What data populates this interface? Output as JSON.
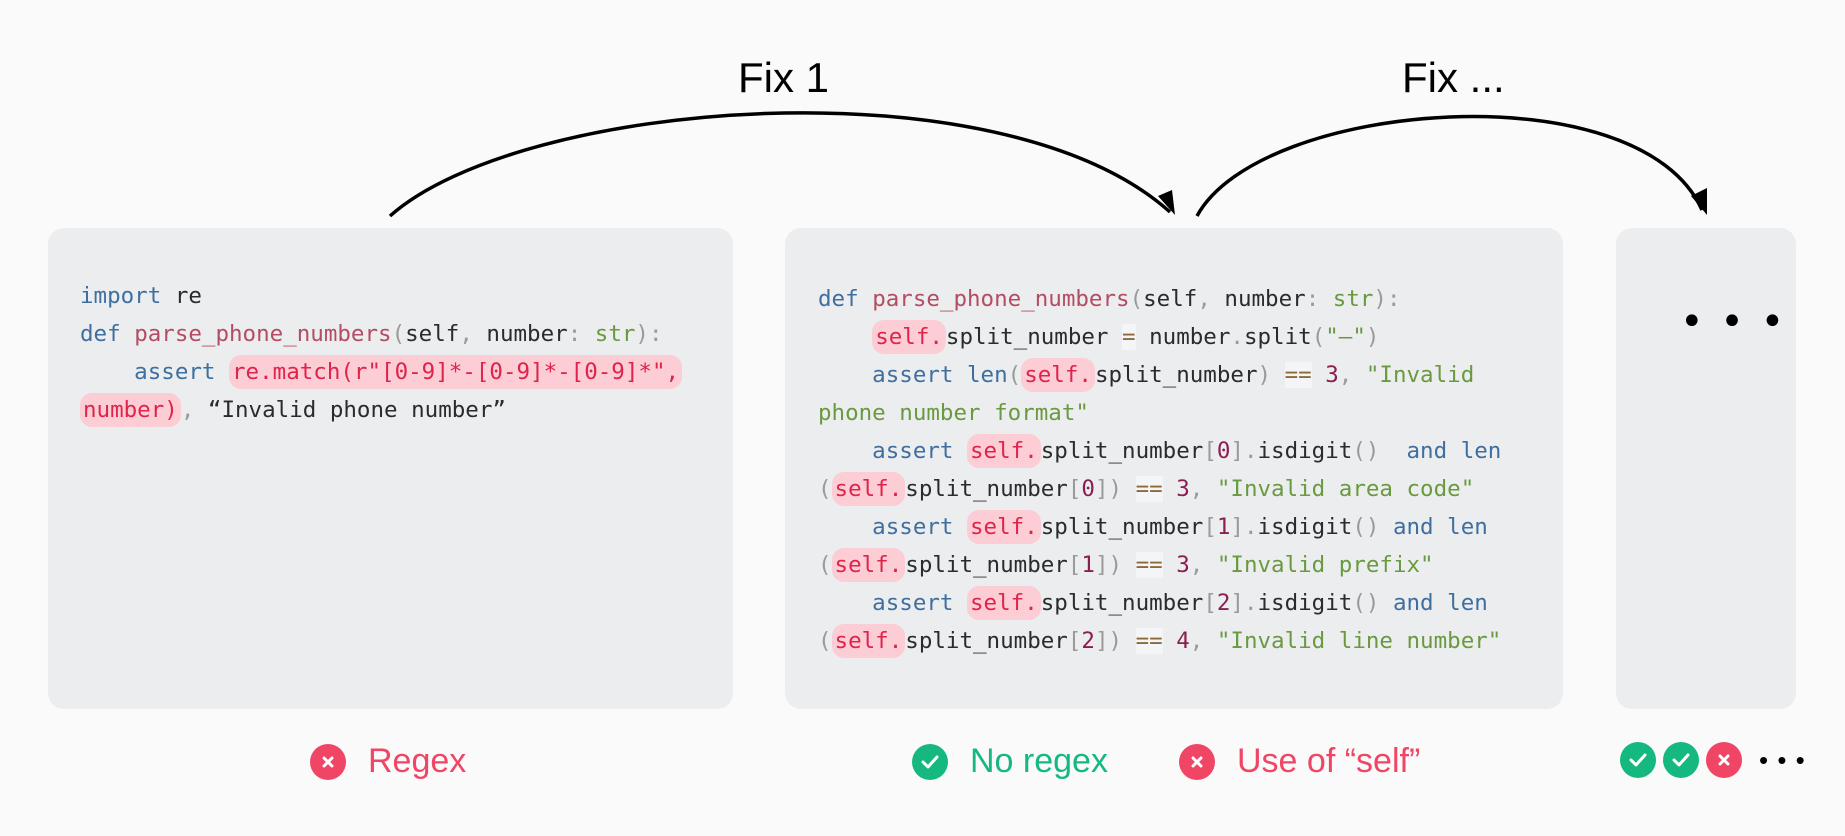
{
  "arrows": {
    "fix1_label": "Fix 1",
    "fix2_label": "Fix ..."
  },
  "box1": {
    "lines": [
      [
        {
          "t": "import",
          "c": "kw"
        },
        {
          "t": " re",
          "c": "plain"
        }
      ],
      [
        {
          "t": "def ",
          "c": "kw"
        },
        {
          "t": "parse_phone_numbers",
          "c": "fn"
        },
        {
          "t": "(",
          "c": "pu"
        },
        {
          "t": "self",
          "c": "plain"
        },
        {
          "t": ", ",
          "c": "pu"
        },
        {
          "t": "number",
          "c": "plain"
        },
        {
          "t": ": ",
          "c": "pu"
        },
        {
          "t": "str",
          "c": "ty"
        },
        {
          "t": "):",
          "c": "pu"
        }
      ],
      [
        {
          "t": "    assert ",
          "c": "kw"
        },
        {
          "t": "re.match(r\"[0-9]*-[0-9]*-[0-9]*\",",
          "c": "hl"
        }
      ],
      [
        {
          "t": "number)",
          "c": "hl"
        },
        {
          "t": ", ",
          "c": "pu"
        },
        {
          "t": "“Invalid phone number”",
          "c": "plain"
        }
      ]
    ]
  },
  "box2": {
    "lines": [
      [
        {
          "t": "def ",
          "c": "kw"
        },
        {
          "t": "parse_phone_numbers",
          "c": "fn"
        },
        {
          "t": "(",
          "c": "pu"
        },
        {
          "t": "self",
          "c": "plain"
        },
        {
          "t": ", ",
          "c": "pu"
        },
        {
          "t": "number",
          "c": "plain"
        },
        {
          "t": ": ",
          "c": "pu"
        },
        {
          "t": "str",
          "c": "ty"
        },
        {
          "t": "):",
          "c": "pu"
        }
      ],
      [
        {
          "t": "    ",
          "c": "plain"
        },
        {
          "t": "self.",
          "c": "hl"
        },
        {
          "t": "split_number ",
          "c": "plain"
        },
        {
          "t": "=",
          "c": "op"
        },
        {
          "t": " number",
          "c": "plain"
        },
        {
          "t": ".",
          "c": "pu"
        },
        {
          "t": "split",
          "c": "plain"
        },
        {
          "t": "(",
          "c": "pu"
        },
        {
          "t": "\"–\"",
          "c": "st"
        },
        {
          "t": ")",
          "c": "pu"
        }
      ],
      [
        {
          "t": "    assert ",
          "c": "kw"
        },
        {
          "t": "len",
          "c": "kw"
        },
        {
          "t": "(",
          "c": "pu"
        },
        {
          "t": "self.",
          "c": "hl"
        },
        {
          "t": "split_number",
          "c": "plain"
        },
        {
          "t": ") ",
          "c": "pu"
        },
        {
          "t": "==",
          "c": "op"
        },
        {
          "t": " ",
          "c": "plain"
        },
        {
          "t": "3",
          "c": "nm"
        },
        {
          "t": ", ",
          "c": "pu"
        },
        {
          "t": "\"Invalid",
          "c": "st"
        }
      ],
      [
        {
          "t": "phone number format\"",
          "c": "st"
        }
      ],
      [
        {
          "t": "    assert ",
          "c": "kw"
        },
        {
          "t": "self.",
          "c": "hl"
        },
        {
          "t": "split_number",
          "c": "plain"
        },
        {
          "t": "[",
          "c": "pu"
        },
        {
          "t": "0",
          "c": "nm"
        },
        {
          "t": "]",
          "c": "pu"
        },
        {
          "t": ".",
          "c": "pu"
        },
        {
          "t": "isdigit",
          "c": "plain"
        },
        {
          "t": "()  ",
          "c": "pu"
        },
        {
          "t": "and ",
          "c": "kw"
        },
        {
          "t": "len",
          "c": "kw"
        }
      ],
      [
        {
          "t": "(",
          "c": "pu"
        },
        {
          "t": "self.",
          "c": "hl"
        },
        {
          "t": "split_number",
          "c": "plain"
        },
        {
          "t": "[",
          "c": "pu"
        },
        {
          "t": "0",
          "c": "nm"
        },
        {
          "t": "]) ",
          "c": "pu"
        },
        {
          "t": "==",
          "c": "op"
        },
        {
          "t": " ",
          "c": "plain"
        },
        {
          "t": "3",
          "c": "nm"
        },
        {
          "t": ", ",
          "c": "pu"
        },
        {
          "t": "\"Invalid area code\"",
          "c": "st"
        }
      ],
      [
        {
          "t": "    assert ",
          "c": "kw"
        },
        {
          "t": "self.",
          "c": "hl"
        },
        {
          "t": "split_number",
          "c": "plain"
        },
        {
          "t": "[",
          "c": "pu"
        },
        {
          "t": "1",
          "c": "nm"
        },
        {
          "t": "]",
          "c": "pu"
        },
        {
          "t": ".",
          "c": "pu"
        },
        {
          "t": "isdigit",
          "c": "plain"
        },
        {
          "t": "() ",
          "c": "pu"
        },
        {
          "t": "and ",
          "c": "kw"
        },
        {
          "t": "len",
          "c": "kw"
        }
      ],
      [
        {
          "t": "(",
          "c": "pu"
        },
        {
          "t": "self.",
          "c": "hl"
        },
        {
          "t": "split_number",
          "c": "plain"
        },
        {
          "t": "[",
          "c": "pu"
        },
        {
          "t": "1",
          "c": "nm"
        },
        {
          "t": "]) ",
          "c": "pu"
        },
        {
          "t": "==",
          "c": "op"
        },
        {
          "t": " ",
          "c": "plain"
        },
        {
          "t": "3",
          "c": "nm"
        },
        {
          "t": ", ",
          "c": "pu"
        },
        {
          "t": "\"Invalid prefix\"",
          "c": "st"
        }
      ],
      [
        {
          "t": "    assert ",
          "c": "kw"
        },
        {
          "t": "self.",
          "c": "hl"
        },
        {
          "t": "split_number",
          "c": "plain"
        },
        {
          "t": "[",
          "c": "pu"
        },
        {
          "t": "2",
          "c": "nm"
        },
        {
          "t": "]",
          "c": "pu"
        },
        {
          "t": ".",
          "c": "pu"
        },
        {
          "t": "isdigit",
          "c": "plain"
        },
        {
          "t": "() ",
          "c": "pu"
        },
        {
          "t": "and ",
          "c": "kw"
        },
        {
          "t": "len",
          "c": "kw"
        }
      ],
      [
        {
          "t": "(",
          "c": "pu"
        },
        {
          "t": "self.",
          "c": "hl"
        },
        {
          "t": "split_number",
          "c": "plain"
        },
        {
          "t": "[",
          "c": "pu"
        },
        {
          "t": "2",
          "c": "nm"
        },
        {
          "t": "]) ",
          "c": "pu"
        },
        {
          "t": "==",
          "c": "op"
        },
        {
          "t": " ",
          "c": "plain"
        },
        {
          "t": "4",
          "c": "nm"
        },
        {
          "t": ", ",
          "c": "pu"
        },
        {
          "t": "\"Invalid line number\"",
          "c": "st"
        }
      ]
    ]
  },
  "box3": {
    "ellipsis": "• • •"
  },
  "status": {
    "s1": {
      "label": "Regex",
      "state": "fail"
    },
    "s2": {
      "label": "No regex",
      "state": "pass"
    },
    "s3": {
      "label": "Use of “self”",
      "state": "fail"
    },
    "s4": {
      "badges": [
        "pass",
        "pass",
        "fail"
      ],
      "more": "• • •"
    }
  },
  "colors": {
    "fail": "#f04565",
    "pass": "#15b97f",
    "highlight_bg": "#fccdd5",
    "highlight_fg": "#e0234a",
    "box_bg": "#ecedef",
    "page_bg": "#fafafa"
  }
}
